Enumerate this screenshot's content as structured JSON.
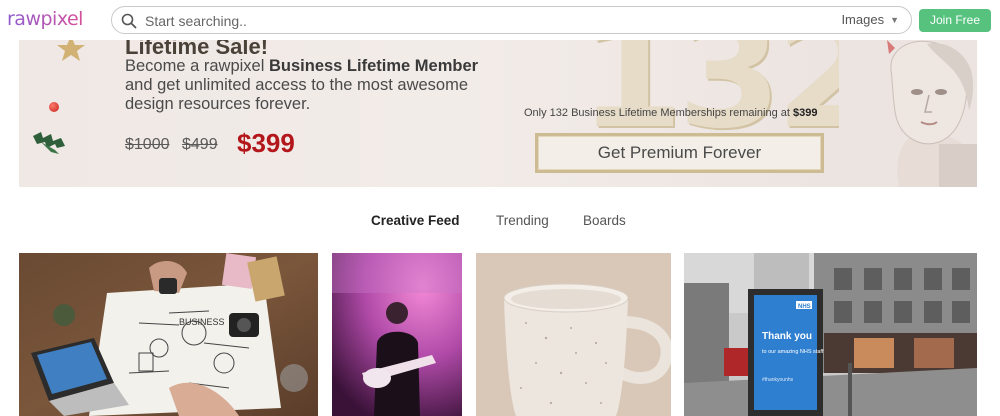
{
  "header": {
    "logo": "rawpixel",
    "search_placeholder": "Start searching..",
    "search_scope": "Images",
    "join_label": "Join Free"
  },
  "banner": {
    "title": "Lifetime Sale!",
    "line_pre": "Become a rawpixel ",
    "line_bold": "Business Lifetime Member",
    "line_rest": "and get unlimited access to the most awesome design resources forever.",
    "price_old_1": "$1000",
    "price_old_2": "$499",
    "price_new": "$399",
    "big_number": "132",
    "remaining_pre": "Only 132 Business Lifetime Memberships remaining at ",
    "remaining_price": "$399",
    "cta_label": "Get Premium Forever"
  },
  "tabs": [
    {
      "label": "Creative Feed",
      "active": true
    },
    {
      "label": "Trending",
      "active": false
    },
    {
      "label": "Boards",
      "active": false
    }
  ],
  "feed": {
    "sign_title": "Thank you",
    "sign_body": "to our amazing NHS staff",
    "sign_tag": "#thankyounhs",
    "sign_logo": "NHS"
  },
  "colors": {
    "join": "#56c27e",
    "price_new": "#b3161b",
    "active_tab": "#222222"
  }
}
